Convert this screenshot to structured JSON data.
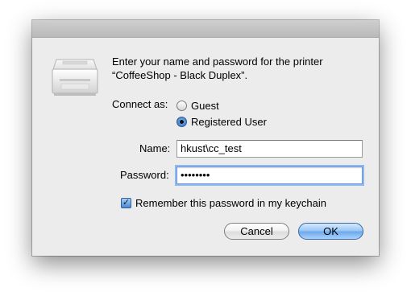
{
  "dialog": {
    "message_line1": "Enter your name and password for the printer",
    "message_line2": "“CoffeeShop - Black Duplex”."
  },
  "connect": {
    "label": "Connect as:",
    "options": [
      "Guest",
      "Registered User"
    ],
    "selected": "Registered User"
  },
  "fields": {
    "name_label": "Name:",
    "name_value": "hkust\\cc_test",
    "password_label": "Password:",
    "password_value": "••••••••"
  },
  "remember": {
    "label": "Remember this password in my keychain",
    "checked": true
  },
  "buttons": {
    "cancel": "Cancel",
    "ok": "OK"
  },
  "icons": {
    "printer": "printer-icon",
    "checkmark": "✓"
  }
}
